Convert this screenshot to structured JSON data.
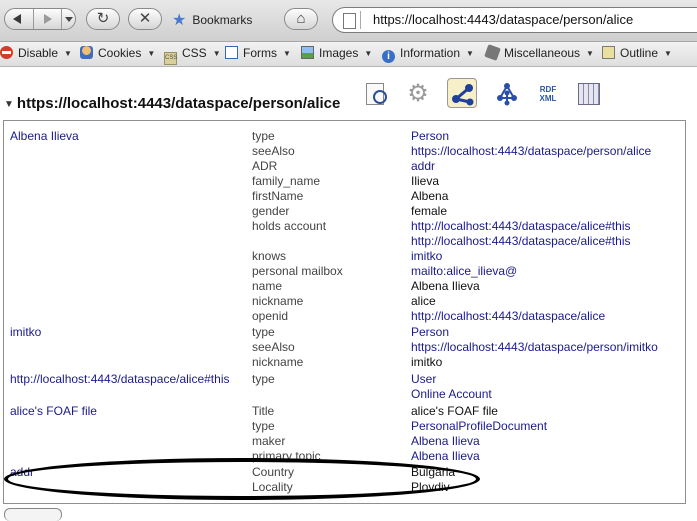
{
  "browser": {
    "bookmarks_label": "Bookmarks",
    "reload_glyph": "↻",
    "stop_glyph": "✕",
    "home_glyph": "⌂",
    "url": "https://localhost:4443/dataspace/person/alice"
  },
  "devtoolbar": [
    {
      "label": "Disable",
      "icon": "disable-icon"
    },
    {
      "label": "Cookies",
      "icon": "cookies-icon"
    },
    {
      "label": "CSS",
      "icon": "css-icon"
    },
    {
      "label": "Forms",
      "icon": "forms-icon"
    },
    {
      "label": "Images",
      "icon": "images-icon"
    },
    {
      "label": "Information",
      "icon": "information-icon"
    },
    {
      "label": "Miscellaneous",
      "icon": "miscellaneous-icon"
    },
    {
      "label": "Outline",
      "icon": "outline-icon"
    }
  ],
  "page": {
    "heading": "https://localhost:4443/dataspace/person/alice",
    "rdf_icon_text": "RDF XML"
  },
  "rows": [
    {
      "subject": "Albena Ilieva",
      "predicate": "type",
      "object": "Person",
      "object_link": true
    },
    {
      "subject": "",
      "predicate": "seeAlso",
      "object": "https://localhost:4443/dataspace/person/alice",
      "object_link": true
    },
    {
      "subject": "",
      "predicate": "ADR",
      "object": "addr",
      "object_link": true
    },
    {
      "subject": "",
      "predicate": "family_name",
      "object": "Ilieva",
      "object_link": false
    },
    {
      "subject": "",
      "predicate": "firstName",
      "object": "Albena",
      "object_link": false
    },
    {
      "subject": "",
      "predicate": "gender",
      "object": "female",
      "object_link": false
    },
    {
      "subject": "",
      "predicate": "holds account",
      "object": "http://localhost:4443/dataspace/alice#this",
      "object_link": true
    },
    {
      "subject": "",
      "predicate": "",
      "object": "http://localhost:4443/dataspace/alice#this",
      "object_link": true
    },
    {
      "subject": "",
      "predicate": "knows",
      "object": "imitko",
      "object_link": true
    },
    {
      "subject": "",
      "predicate": "personal mailbox",
      "object": "mailto:alice_ilieva@",
      "object_link": true
    },
    {
      "subject": "",
      "predicate": "name",
      "object": "Albena Ilieva",
      "object_link": false
    },
    {
      "subject": "",
      "predicate": "nickname",
      "object": "alice",
      "object_link": false
    },
    {
      "subject": "",
      "predicate": "openid",
      "object": "http://localhost:4443/dataspace/alice",
      "object_link": true
    },
    {
      "subject": "imitko",
      "predicate": "type",
      "object": "Person",
      "object_link": true
    },
    {
      "subject": "",
      "predicate": "seeAlso",
      "object": "https://localhost:4443/dataspace/person/imitko",
      "object_link": true
    },
    {
      "subject": "",
      "predicate": "nickname",
      "object": "imitko",
      "object_link": false
    },
    {
      "subject": "http://localhost:4443/dataspace/alice#this",
      "predicate": "type",
      "object": "User",
      "object_link": true
    },
    {
      "subject": "",
      "predicate": "",
      "object": "Online Account",
      "object_link": true
    },
    {
      "subject": "alice's FOAF file",
      "predicate": "Title",
      "object": "alice's FOAF file",
      "object_link": false
    },
    {
      "subject": "",
      "predicate": "type",
      "object": "PersonalProfileDocument",
      "object_link": true
    },
    {
      "subject": "",
      "predicate": "maker",
      "object": "Albena Ilieva",
      "object_link": true
    },
    {
      "subject": "",
      "predicate": "primary topic",
      "object": "Albena Ilieva",
      "object_link": true
    },
    {
      "subject": "addr",
      "predicate": "Country",
      "object": "Bulgaria",
      "object_link": false
    },
    {
      "subject": "",
      "predicate": "Locality",
      "object": "Plovdiv",
      "object_link": false
    }
  ]
}
